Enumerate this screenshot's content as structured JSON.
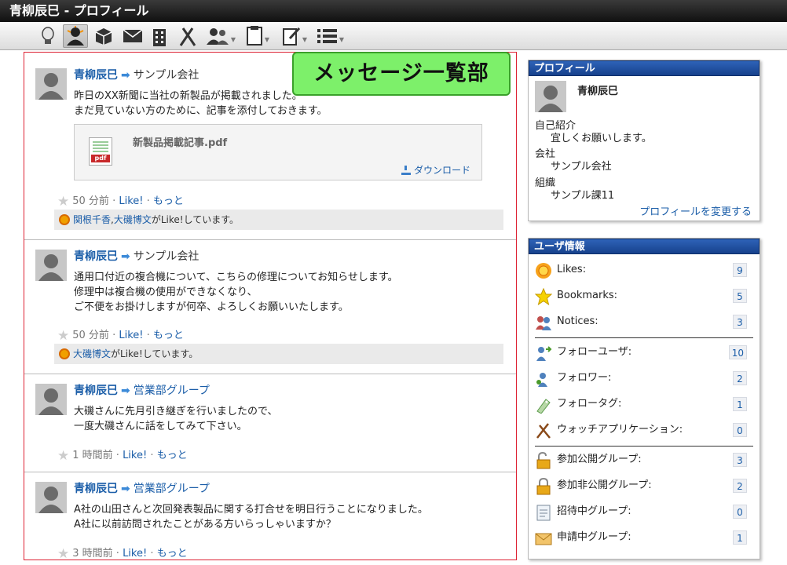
{
  "window": {
    "title": "青柳辰巳 - プロフィール"
  },
  "toolbar": {
    "icons": [
      "lightbulb-icon",
      "profile-icon",
      "box-icon",
      "mail-icon",
      "building-icon",
      "tools-icon",
      "users-icon",
      "document-icon",
      "edit-icon",
      "list-icon"
    ]
  },
  "callout": "メッセージ一覧部",
  "messages": [
    {
      "user": "青柳辰巳",
      "target": "サンプル会社",
      "lines": [
        "昨日のXX新聞に当社の新製品が掲載されました。",
        "まだ見ていない方のために、記事を添付しておきます。"
      ],
      "attachment": {
        "name": "新製品掲載記事.pdf",
        "download": "ダウンロード",
        "tag": "pdf"
      },
      "time": "50 分前",
      "like": "Like!",
      "more": "もっと",
      "likers": [
        "関根千香",
        "大磯博文"
      ],
      "liker_sep": ",",
      "liked_suffix": "がLike!しています。"
    },
    {
      "user": "青柳辰巳",
      "target": "サンプル会社",
      "lines": [
        "通用口付近の複合機について、こちらの修理についてお知らせします。",
        "修理中は複合機の使用ができなくなり、",
        "ご不便をお掛けしますが何卒、よろしくお願いいたします。"
      ],
      "time": "50 分前",
      "like": "Like!",
      "more": "もっと",
      "likers": [
        "大磯博文"
      ],
      "liked_suffix": "がLike!しています。"
    },
    {
      "user": "青柳辰巳",
      "target": "営業部グループ",
      "lines": [
        "大磯さんに先月引き継ぎを行いましたので、",
        "一度大磯さんに話をしてみて下さい。"
      ],
      "time": "1 時間前",
      "like": "Like!",
      "more": "もっと"
    },
    {
      "user": "青柳辰巳",
      "target": "営業部グループ",
      "lines": [
        "A社の山田さんと次回発表製品に関する打合せを明日行うことになりました。",
        "A社に以前訪問されたことがある方いらっしゃいますか？"
      ],
      "time": "3 時間前",
      "like": "Like!",
      "more": "もっと"
    }
  ],
  "profile": {
    "header": "プロフィール",
    "name": "青柳辰巳",
    "intro_label": "自己紹介",
    "intro": "宜しくお願いします。",
    "company_label": "会社",
    "company": "サンプル会社",
    "org_label": "組織",
    "org": "サンプル課11",
    "edit_link": "プロフィールを変更する"
  },
  "user_info": {
    "header": "ユーザ情報",
    "stats": [
      {
        "label": "Likes:",
        "count": "9",
        "icon": "sun-icon"
      },
      {
        "label": "Bookmarks:",
        "count": "5",
        "icon": "star-icon"
      },
      {
        "label": "Notices:",
        "count": "3",
        "icon": "people-icon"
      }
    ],
    "follows": [
      {
        "label": "フォローユーザ:",
        "count": "10",
        "icon": "follow-user-icon"
      },
      {
        "label": "フォロワー:",
        "count": "2",
        "icon": "follower-icon"
      },
      {
        "label": "フォロータグ:",
        "count": "1",
        "icon": "tag-icon"
      },
      {
        "label": "ウォッチアプリケーション:",
        "count": "0",
        "icon": "tools-icon"
      }
    ],
    "groups": [
      {
        "label": "参加公開グループ:",
        "count": "3",
        "icon": "open-lock-icon"
      },
      {
        "label": "参加非公開グループ:",
        "count": "2",
        "icon": "lock-icon"
      },
      {
        "label": "招待中グループ:",
        "count": "0",
        "icon": "invite-icon"
      },
      {
        "label": "申請中グループ:",
        "count": "1",
        "icon": "envelope-icon"
      }
    ]
  },
  "colors": {
    "accent": "#1a5da8",
    "panel_header": "#17418c",
    "callout": "#7df06a",
    "feed_border": "#dd2233"
  }
}
